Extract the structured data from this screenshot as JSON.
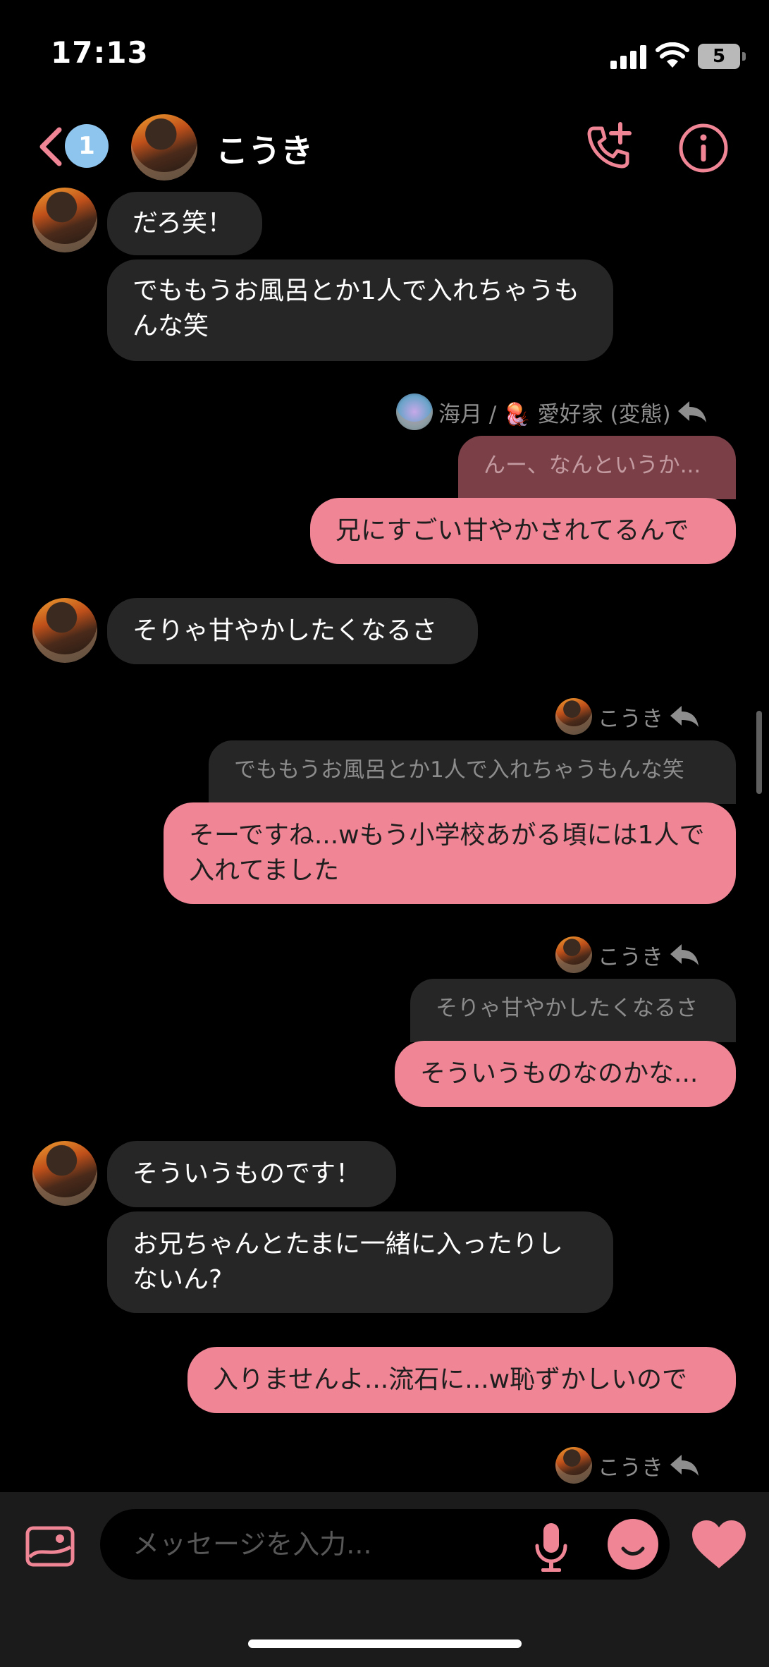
{
  "status_bar": {
    "time": "17:13",
    "battery": "5"
  },
  "header": {
    "unread_count": "1",
    "contact_name": "こうき"
  },
  "colors": {
    "accent": "#ef8595",
    "bubble_in": "#262626",
    "background": "#000000",
    "badge": "#8ec5ee"
  },
  "icons": [
    "chevron-left-icon",
    "add-call-icon",
    "info-icon",
    "image-icon",
    "mic-icon",
    "sticker-icon",
    "heart-icon",
    "reply-icon"
  ],
  "messages": {
    "m1": "だろ笑！",
    "m2": "でももうお風呂とか1人で入れちゃうもんな笑",
    "r1_sender": "海月 / 🪼 愛好家 (変態)",
    "r1_quote": "んー、なんというか...",
    "m3": "兄にすごい甘やかされてるんで",
    "m4": "そりゃ甘やかしたくなるさ",
    "r2_sender": "こうき",
    "r2_quote": "でももうお風呂とか1人で入れちゃうもんな笑",
    "m5": "そーですね...wもう小学校あがる頃には1人で入れてました",
    "r3_sender": "こうき",
    "r3_quote": "そりゃ甘やかしたくなるさ",
    "m6": "そういうものなのかな...",
    "m7": "そういうものです！",
    "m8": "お兄ちゃんとたまに一緒に入ったりしないん?",
    "m9": "入りませんよ...流石に...w恥ずかしいので",
    "r4_sender": "こうき"
  },
  "composer": {
    "placeholder": "メッセージを入力..."
  }
}
